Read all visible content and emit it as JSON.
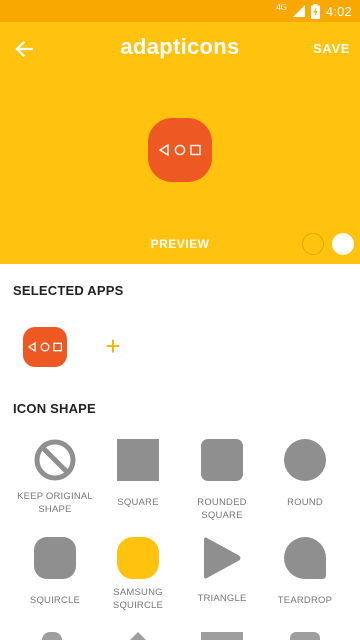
{
  "status_bar": {
    "network": "4G",
    "time": "4:02"
  },
  "header": {
    "title": "adapticons",
    "save_label": "SAVE",
    "preview_label": "PREVIEW"
  },
  "sections": {
    "selected_apps_title": "SELECTED APPS",
    "icon_shape_title": "ICON SHAPE"
  },
  "add_label": "+",
  "shapes": [
    {
      "label": "KEEP ORIGINAL SHAPE",
      "icon": "no-shape-icon"
    },
    {
      "label": "SQUARE",
      "icon": "square-icon"
    },
    {
      "label": "ROUNDED SQUARE",
      "icon": "rounded-square-icon"
    },
    {
      "label": "ROUND",
      "icon": "round-icon"
    },
    {
      "label": "SQUIRCLE",
      "icon": "squircle-icon"
    },
    {
      "label": "SAMSUNG SQUIRCLE",
      "icon": "samsung-squircle-icon",
      "selected": true
    },
    {
      "label": "TRIANGLE",
      "icon": "triangle-icon"
    },
    {
      "label": "TEARDROP",
      "icon": "teardrop-icon"
    }
  ],
  "colors": {
    "accent": "#ffc20e",
    "status_bar": "#f8a800",
    "icon_orange": "#ee5822",
    "shape_gray": "#8f8f8f"
  }
}
